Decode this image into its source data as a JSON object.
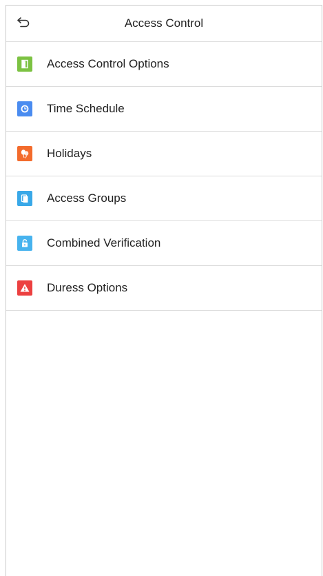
{
  "header": {
    "title": "Access Control",
    "back_icon": "back-arrow-icon"
  },
  "menu": {
    "items": [
      {
        "label": "Access Control Options",
        "icon": "door-icon",
        "color": "#7cc242"
      },
      {
        "label": "Time Schedule",
        "icon": "clock-icon",
        "color": "#4a8cf0"
      },
      {
        "label": "Holidays",
        "icon": "balloons-icon",
        "color": "#f36b2c"
      },
      {
        "label": "Access Groups",
        "icon": "group-icon",
        "color": "#39a8e8"
      },
      {
        "label": "Combined Verification",
        "icon": "unlock-icon",
        "color": "#47b3ee"
      },
      {
        "label": "Duress Options",
        "icon": "warning-icon",
        "color": "#ec4040"
      }
    ]
  }
}
